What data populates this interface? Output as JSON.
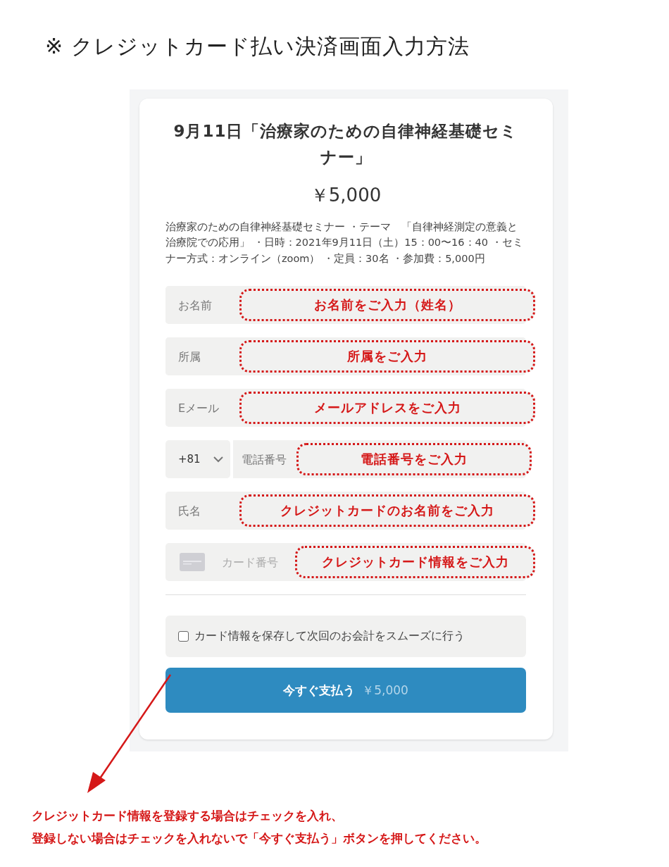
{
  "heading": "※ クレジットカード払い決済画面入力方法",
  "checkout": {
    "title": "9月11日「治療家のための自律神経基礎セミナー」",
    "price": "￥5,000",
    "description": "治療家のための自律神経基礎セミナー ・テーマ　「自律神経測定の意義と治療院での応用」 ・日時：2021年9月11日（土）15：00〜16：40 ・セミナー方式：オンライン（zoom） ・定員：30名 ・参加費：5,000円",
    "fields": [
      {
        "kind": "text",
        "placeholder": "お名前",
        "annotation": "お名前をご入力（姓名）"
      },
      {
        "kind": "text",
        "placeholder": "所属",
        "annotation": "所属をご入力"
      },
      {
        "kind": "text",
        "placeholder": "Eメール",
        "annotation": "メールアドレスをご入力"
      },
      {
        "kind": "phone",
        "country_code": "+81",
        "placeholder": "電話番号",
        "annotation": "電話番号をご入力"
      },
      {
        "kind": "text",
        "placeholder": "氏名",
        "annotation": "クレジットカードのお名前をご入力"
      },
      {
        "kind": "card",
        "placeholder": "カード番号",
        "annotation": "クレジットカード情報をご入力"
      }
    ],
    "save_card": {
      "label": "カード情報を保存して次回のお会計をスムーズに行う",
      "checked": false
    },
    "pay_button": {
      "label": "今すぐ支払う",
      "amount": "￥5,000"
    }
  },
  "note_lines": [
    "クレジットカード情報を登録する場合はチェックを入れ、",
    "登録しない場合はチェックを入れないで「今すぐ支払う」ボタンを押してください。"
  ]
}
